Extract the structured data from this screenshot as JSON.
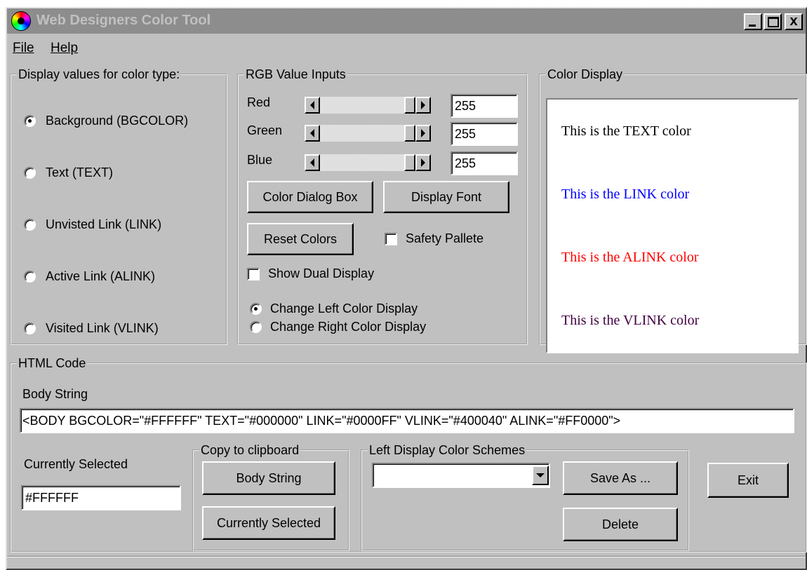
{
  "window": {
    "title": "Web Designers Color Tool",
    "controls": {
      "minimize": "_",
      "maximize": "□",
      "close": "x"
    }
  },
  "menu": {
    "file": "File",
    "help": "Help"
  },
  "color_type": {
    "legend": "Display values for color type:",
    "options": [
      {
        "label": "Background (BGCOLOR)",
        "selected": true
      },
      {
        "label": "Text (TEXT)",
        "selected": false
      },
      {
        "label": "Unvisted Link (LINK)",
        "selected": false
      },
      {
        "label": "Active Link (ALINK)",
        "selected": false
      },
      {
        "label": "Visited Link (VLINK)",
        "selected": false
      }
    ]
  },
  "rgb": {
    "legend": "RGB Value Inputs",
    "channels": [
      {
        "label": "Red",
        "value": "255",
        "level": 255,
        "max": 255
      },
      {
        "label": "Green",
        "value": "255",
        "level": 255,
        "max": 255
      },
      {
        "label": "Blue",
        "value": "255",
        "level": 255,
        "max": 255
      }
    ],
    "color_dialog_button": "Color Dialog Box",
    "display_font_button": "Display Font",
    "reset_colors_button": "Reset Colors",
    "safety_pallete": {
      "label": "Safety Pallete",
      "checked": false
    },
    "show_dual_display": {
      "label": "Show Dual Display",
      "checked": false
    },
    "change_left": {
      "label": "Change Left Color Display",
      "selected": true
    },
    "change_right": {
      "label": "Change Right Color Display",
      "selected": false
    }
  },
  "color_display": {
    "legend": "Color Display",
    "background": "#FFFFFF",
    "lines": [
      {
        "text": "This is the TEXT color",
        "color": "#000000"
      },
      {
        "text": "This is the LINK color",
        "color": "#0000FF"
      },
      {
        "text": "This is the ALINK color",
        "color": "#FF0000"
      },
      {
        "text": "This is the VLINK color",
        "color": "#400040"
      }
    ]
  },
  "html_code": {
    "legend": "HTML Code",
    "body_string_label": "Body String",
    "body_string": "<BODY BGCOLOR=\"#FFFFFF\" TEXT=\"#000000\" LINK=\"#0000FF\" VLINK=\"#400040\" ALINK=\"#FF0000\">",
    "currently_selected_label": "Currently Selected",
    "currently_selected_value": "#FFFFFF",
    "clipboard": {
      "legend": "Copy to clipboard",
      "body_string_button": "Body String",
      "currently_selected_button": "Currently Selected"
    },
    "schemes": {
      "legend": "Left Display Color Schemes",
      "selected": "",
      "save_as_button": "Save As ...",
      "delete_button": "Delete"
    },
    "exit_button": "Exit"
  }
}
